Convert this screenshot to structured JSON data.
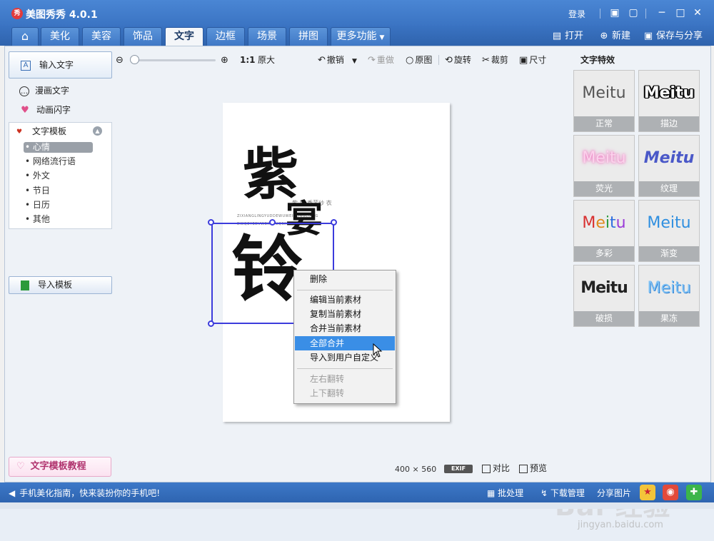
{
  "window": {
    "title": "美图秀秀 4.0.1",
    "logo_text": "秀",
    "login": "登录"
  },
  "tabs": [
    {
      "label": "美化"
    },
    {
      "label": "美容"
    },
    {
      "label": "饰品"
    },
    {
      "label": "文字"
    },
    {
      "label": "边框"
    },
    {
      "label": "场景"
    },
    {
      "label": "拼图"
    },
    {
      "label": "更多功能"
    }
  ],
  "active_tab": "文字",
  "actions": {
    "open": "打开",
    "new": "新建",
    "save_share": "保存与分享"
  },
  "left_panel": {
    "input_text": "输入文字",
    "comic_text": "漫画文字",
    "animated_text": "动画闪字",
    "template_header": "文字模板",
    "categories": [
      {
        "label": "心情",
        "selected": true
      },
      {
        "label": "网络流行语"
      },
      {
        "label": "外文"
      },
      {
        "label": "节日"
      },
      {
        "label": "日历"
      },
      {
        "label": "其他"
      }
    ],
    "import_template": "导入模板",
    "tutorial": "文字模板教程"
  },
  "toolbar": {
    "ratio": "1:1",
    "original_size": "原大",
    "undo": "撤销",
    "redo": "重做",
    "original": "原图",
    "rotate": "旋转",
    "crop": "裁剪",
    "size": "尺寸"
  },
  "canvas": {
    "glyph_1": "紫",
    "glyph_2": "宴",
    "glyph_3": "铃",
    "tagline": "紫 宴 香菲纱 衣",
    "pinyin_1": "ZIXIANGLINGYUDDEWUWEIDONGLIANG",
    "pinyin_2": "DWQEYEDVWEXIWUQSXIALUDE"
  },
  "context_menu": {
    "items": [
      {
        "label": "删除"
      },
      {
        "label": "编辑当前素材"
      },
      {
        "label": "复制当前素材"
      },
      {
        "label": "合并当前素材"
      },
      {
        "label": "全部合并",
        "highlight": true
      },
      {
        "label": "导入到用户自定义"
      },
      {
        "label": "左右翻转",
        "disabled": true
      },
      {
        "label": "上下翻转",
        "disabled": true
      }
    ]
  },
  "image_info": {
    "width": "400",
    "times": "×",
    "height": "560",
    "exif": "EXIF",
    "compare": "对比",
    "preview": "预览"
  },
  "effects": {
    "title": "文字特效",
    "sample_text": "Meitu",
    "items": [
      {
        "label": "正常",
        "color": "#555555"
      },
      {
        "label": "描边",
        "color": "#111111"
      },
      {
        "label": "荧光",
        "color": "#f4a6d7"
      },
      {
        "label": "纹理",
        "color": "#4a58c8"
      },
      {
        "label": "多彩",
        "color": "#d83030"
      },
      {
        "label": "渐变",
        "color": "#2f8fe0"
      },
      {
        "label": "破损",
        "color": "#222222"
      },
      {
        "label": "果冻",
        "color": "#4fa6ee"
      }
    ]
  },
  "statusbar": {
    "message": "手机美化指南，快来装扮你的手机吧!",
    "batch": "批处理",
    "download": "下载管理",
    "share": "分享图片"
  },
  "watermark": {
    "brand": "Bai 经验",
    "url": "jingyan.baidu.com"
  },
  "colors": {
    "titlebar": "#3a73c2",
    "highlight": "#3a8ee6",
    "selection": "#3c3cdc"
  }
}
